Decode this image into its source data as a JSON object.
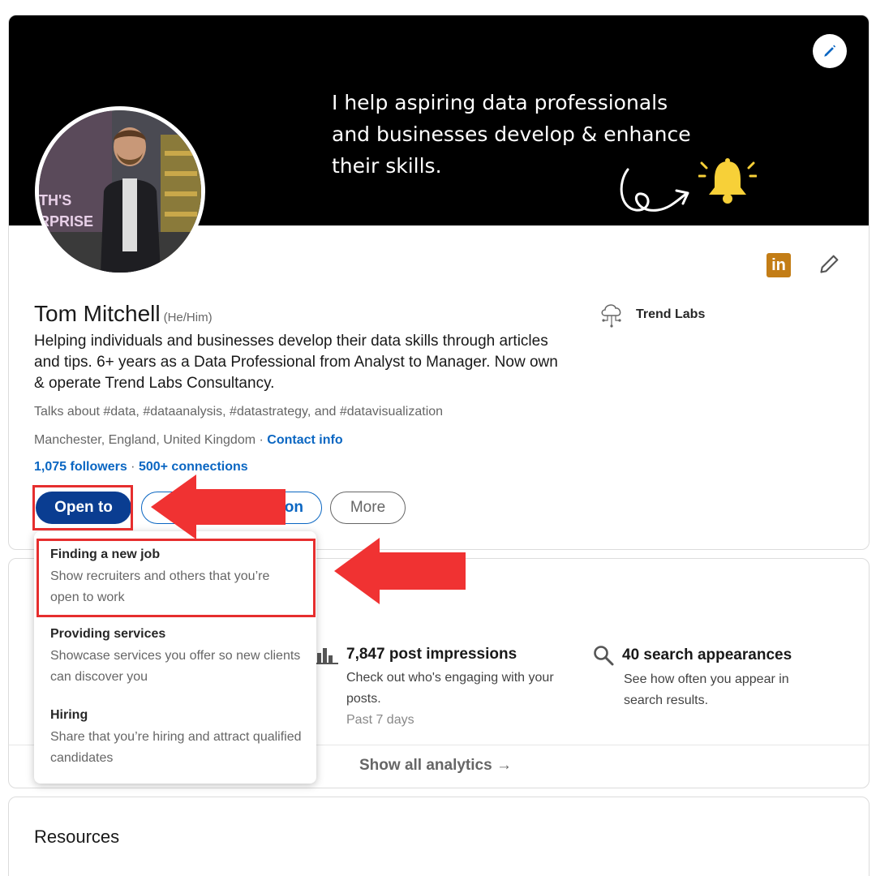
{
  "banner": {
    "text": "I help aspiring data professionals\nand businesses develop & enhance\ntheir skills."
  },
  "avatar": {
    "overlay_text_1": "TH'S",
    "overlay_text_2": "RPRISE"
  },
  "profile": {
    "name": "Tom Mitchell",
    "pronouns": "(He/Him)",
    "headline": "Helping individuals and businesses develop their data skills through articles and tips. 6+ years as a Data Professional from Analyst to Manager. Now own & operate Trend Labs Consultancy.",
    "talks_about": "Talks about #data, #dataanalysis, #datastrategy, and #datavisualization",
    "location": "Manchester, England, United Kingdom",
    "location_sep": " · ",
    "contact_info": "Contact info",
    "followers": "1,075 followers",
    "followers_sep": " · ",
    "connections": "500+ connections",
    "company": "Trend Labs",
    "linkedin_badge": "in"
  },
  "actions": {
    "open_to": "Open to",
    "add_section": "ion",
    "more": "More"
  },
  "dropdown": {
    "items": [
      {
        "title": "Finding a new job",
        "desc": "Show recruiters and others that you’re open to work"
      },
      {
        "title": "Providing services",
        "desc": "Showcase services you offer so new clients can discover you"
      },
      {
        "title": "Hiring",
        "desc": "Share that you’re hiring and attract qualified candidates"
      }
    ]
  },
  "analytics": {
    "impressions": {
      "title": "7,847 post impressions",
      "desc": "Check out who's engaging with your posts.",
      "sub": "Past 7 days"
    },
    "search": {
      "title": "40 search appearances",
      "desc": "See how often you appear in search results."
    },
    "show_all": "Show all analytics →"
  },
  "resources": {
    "title": "Resources"
  },
  "colors": {
    "link": "#0a66c2",
    "open_to_button": "#0a3d91",
    "highlight": "#e62e2e",
    "linkedin_badge": "#c37d16",
    "bell": "#f7d038"
  },
  "icons": [
    "pencil-icon",
    "linkedin-icon",
    "cloud-network-icon",
    "bar-chart-icon",
    "search-icon",
    "bell-icon",
    "curly-arrow-icon",
    "red-arrow-icon"
  ]
}
